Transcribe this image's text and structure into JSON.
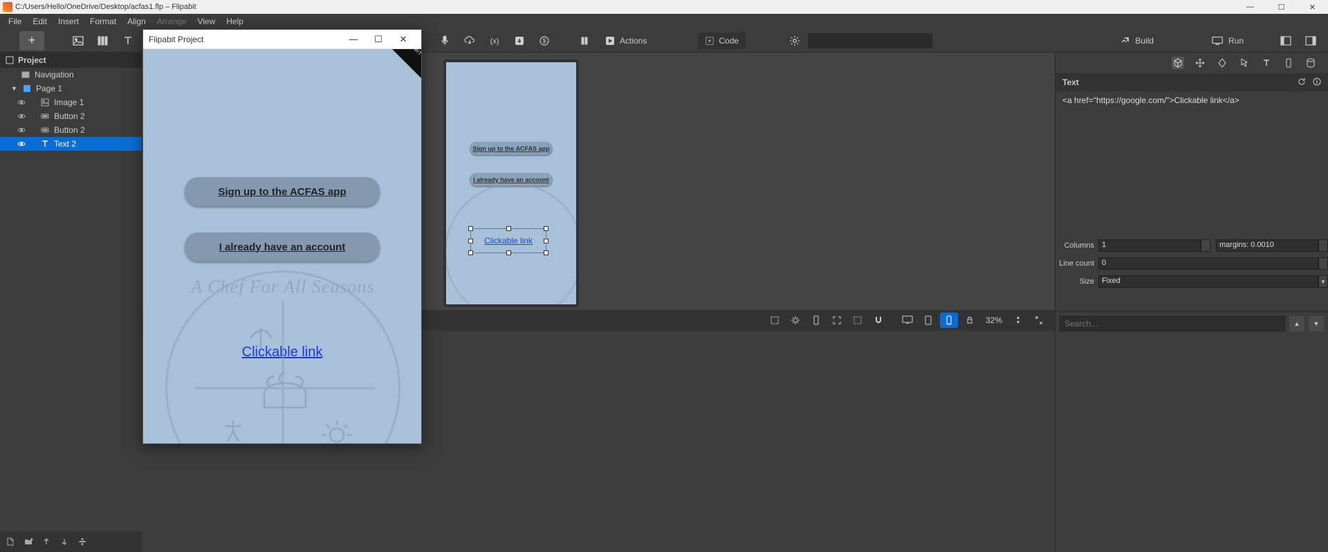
{
  "title": "C:/Users/Hello/OneDrive/Desktop/acfas1.flp – Flipabit",
  "menus": [
    "File",
    "Edit",
    "Insert",
    "Format",
    "Align",
    "Arrange",
    "View",
    "Help"
  ],
  "menus_disabled_index": 5,
  "toolbar": {
    "actions_label": "Actions",
    "code_label": "Code",
    "build_label": "Build",
    "run_label": "Run"
  },
  "project": {
    "header": "Project",
    "nav": "Navigation",
    "page": "Page 1",
    "items": [
      {
        "label": "Image 1",
        "icon": "image"
      },
      {
        "label": "Button 2",
        "icon": "button"
      },
      {
        "label": "Button 2",
        "icon": "button"
      },
      {
        "label": "Text 2",
        "icon": "text",
        "selected": true
      }
    ]
  },
  "preview": {
    "window_title": "Flipabit Project",
    "button1": "Sign up to the ACFAS app",
    "button2": "I already have an account",
    "link": "Clickable link",
    "chef_text": "A Chef For All Seasons"
  },
  "canvas": {
    "button1": "Sign up to the ACFAS app",
    "button2": "I already have an account",
    "link": "Clickable link",
    "zoom": "32%"
  },
  "right": {
    "panel_title": "Text",
    "text_content": "<a href=\"https://google.com/\">Clickable link</a>",
    "columns_label": "Columns",
    "columns_value": "1",
    "margins_value": "margins: 0.0010",
    "linecount_label": "Line count",
    "linecount_value": "0",
    "size_label": "Size",
    "size_value": "Fixed",
    "search_placeholder": "Search..."
  }
}
